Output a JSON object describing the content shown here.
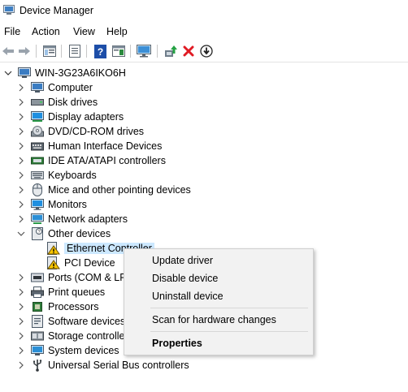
{
  "window": {
    "title": "Device Manager"
  },
  "menu": [
    "File",
    "Action",
    "View",
    "Help"
  ],
  "toolbar": {
    "icons": [
      "back-arrow-icon",
      "forward-arrow-icon",
      "show-hide-console-tree-icon",
      "properties-icon",
      "help-icon",
      "action-pane-icon",
      "monitor-icon",
      "update-driver-icon",
      "uninstall-device-icon",
      "disable-device-icon"
    ]
  },
  "tree": {
    "root": "WIN-3G23A6IKO6H",
    "categories": [
      {
        "label": "Computer",
        "icon": "computer-icon"
      },
      {
        "label": "Disk drives",
        "icon": "disk-drive-icon"
      },
      {
        "label": "Display adapters",
        "icon": "display-adapter-icon"
      },
      {
        "label": "DVD/CD-ROM drives",
        "icon": "dvd-drive-icon"
      },
      {
        "label": "Human Interface Devices",
        "icon": "hid-icon"
      },
      {
        "label": "IDE ATA/ATAPI controllers",
        "icon": "ide-controller-icon"
      },
      {
        "label": "Keyboards",
        "icon": "keyboard-icon"
      },
      {
        "label": "Mice and other pointing devices",
        "icon": "mouse-icon"
      },
      {
        "label": "Monitors",
        "icon": "monitor-icon"
      },
      {
        "label": "Network adapters",
        "icon": "network-adapter-icon"
      },
      {
        "label": "Other devices",
        "icon": "other-devices-icon",
        "expanded": true,
        "children": [
          {
            "label": "Ethernet Controller",
            "icon": "warning-device-icon",
            "selected": true
          },
          {
            "label": "PCI Device",
            "icon": "warning-device-icon"
          }
        ]
      },
      {
        "label": "Ports (COM & LPT)",
        "icon": "ports-icon"
      },
      {
        "label": "Print queues",
        "icon": "printer-icon"
      },
      {
        "label": "Processors",
        "icon": "processor-icon"
      },
      {
        "label": "Software devices",
        "icon": "software-device-icon"
      },
      {
        "label": "Storage controllers",
        "icon": "storage-controller-icon"
      },
      {
        "label": "System devices",
        "icon": "system-device-icon"
      },
      {
        "label": "Universal Serial Bus controllers",
        "icon": "usb-icon"
      }
    ]
  },
  "context_menu": {
    "items": [
      "Update driver",
      "Disable device",
      "Uninstall device"
    ],
    "scan": "Scan for hardware changes",
    "properties": "Properties"
  }
}
